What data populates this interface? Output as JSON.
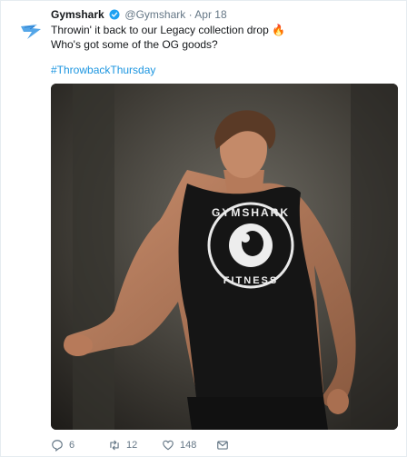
{
  "tweet": {
    "author_name": "Gymshark",
    "author_handle": "@Gymshark",
    "separator": "·",
    "date": "Apr 18",
    "text_line1": "Throwin' it back to our Legacy collection drop 🔥",
    "text_line2": "Who's got some of the OG goods?",
    "hashtag": "#ThrowbackThursday"
  },
  "media": {
    "shirt_text_top": "GYMSHARK",
    "shirt_text_bottom": "FITNESS"
  },
  "actions": {
    "replies": "6",
    "retweets": "12",
    "likes": "148"
  },
  "colors": {
    "brand_blue": "#1da1f2",
    "link_blue": "#1b95e0",
    "meta_gray": "#657786"
  }
}
